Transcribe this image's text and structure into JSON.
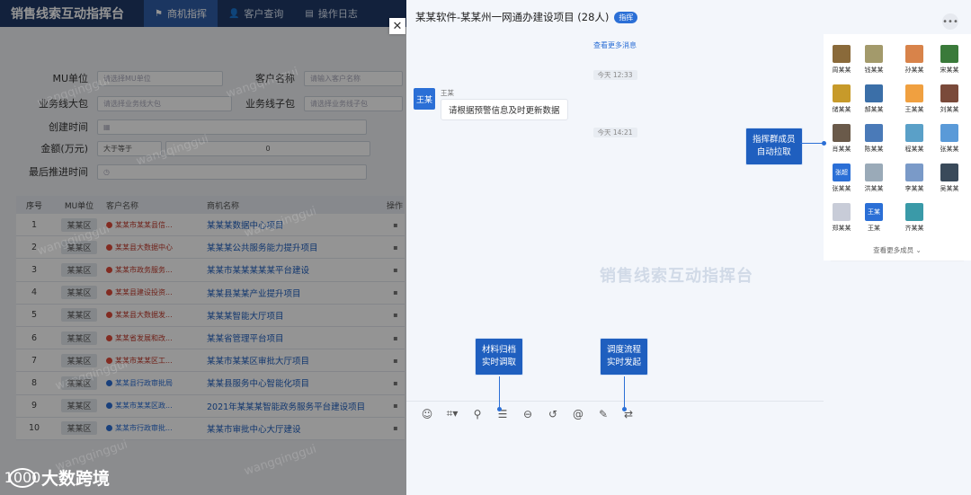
{
  "app": {
    "title": "销售线索互动指挥台",
    "nav": [
      {
        "icon": "flag-icon",
        "glyph": "⚑",
        "label": "商机指挥"
      },
      {
        "icon": "user-icon",
        "glyph": "👤",
        "label": "客户查询"
      },
      {
        "icon": "log-icon",
        "glyph": "▤",
        "label": "操作日志"
      }
    ],
    "filters": {
      "mu_label": "MU单位",
      "mu_placeholder": "请选择MU单位",
      "customer_label": "客户名称",
      "customer_placeholder": "请输入客户名称",
      "biz_pkg_label": "业务线大包",
      "biz_pkg_placeholder": "请选择业务线大包",
      "biz_sub_label": "业务线子包",
      "biz_sub_placeholder": "请选择业务线子包",
      "created_label": "创建时间",
      "amount_label": "金额(万元)",
      "amount_op": "大于等于",
      "amount_value": "0",
      "last_label": "最后推进时间"
    },
    "table": {
      "headers": {
        "no": "序号",
        "mu": "MU单位",
        "customer": "客户名称",
        "opportunity": "商机名称",
        "action": "操作"
      },
      "rows": [
        {
          "no": "1",
          "mu": "某某区",
          "customer": "某某市某某县信...",
          "status": "red",
          "opportunity": "某某某数据中心项目"
        },
        {
          "no": "2",
          "mu": "某某区",
          "customer": "某某县大数据中心",
          "status": "red",
          "opportunity": "某某某公共服务能力提升项目"
        },
        {
          "no": "3",
          "mu": "某某区",
          "customer": "某某市政务服务...",
          "status": "red",
          "opportunity": "某某市某某某某某平台建设"
        },
        {
          "no": "4",
          "mu": "某某区",
          "customer": "某某县建设投资...",
          "status": "red",
          "opportunity": "某某县某某产业提升项目"
        },
        {
          "no": "5",
          "mu": "某某区",
          "customer": "某某县大数据发...",
          "status": "red",
          "opportunity": "某某某智能大厅项目"
        },
        {
          "no": "6",
          "mu": "某某区",
          "customer": "某某省发展和改...",
          "status": "red",
          "opportunity": "某某省管理平台项目"
        },
        {
          "no": "7",
          "mu": "某某区",
          "customer": "某某市某某区工...",
          "status": "red",
          "opportunity": "某某市某某区审批大厅项目"
        },
        {
          "no": "8",
          "mu": "某某区",
          "customer": "某某县行政审批局",
          "status": "blue",
          "opportunity": "某某县服务中心智能化项目"
        },
        {
          "no": "9",
          "mu": "某某区",
          "customer": "某某市某某区政...",
          "status": "blue",
          "opportunity": "2021年某某某智能政务服务平台建设项目"
        },
        {
          "no": "10",
          "mu": "某某区",
          "customer": "某某市行政审批...",
          "status": "blue",
          "opportunity": "某某市审批中心大厅建设"
        }
      ]
    },
    "watermark": "wangqinggui",
    "brand": {
      "logo": "1000",
      "name": "大数跨境"
    }
  },
  "chat": {
    "group_name": "某某软件-某某州一网通办建设项目 (28人)",
    "group_tag": "指挥",
    "load_more": "查看更多消息",
    "time1": "今天 12:33",
    "time2": "今天 14:21",
    "sender_avatar": "王某",
    "sender_name": "王某",
    "message": "请根据预警信息及时更新数据",
    "center_watermark": "销售线索互动指挥台",
    "members_more": "查看更多成员",
    "members": [
      {
        "name": "周某某",
        "color": "#8a6a3a"
      },
      {
        "name": "钱某某",
        "color": "#a39a6b"
      },
      {
        "name": "孙某某",
        "color": "#d8834a"
      },
      {
        "name": "宋某某",
        "color": "#3a7a3a"
      },
      {
        "name": "储某某",
        "color": "#c79a2a"
      },
      {
        "name": "郝某某",
        "color": "#3b6fa8"
      },
      {
        "name": "王某某",
        "color": "#f0a040"
      },
      {
        "name": "刘某某",
        "color": "#7a4a3a"
      },
      {
        "name": "肖某某",
        "color": "#6a5a4a"
      },
      {
        "name": "陈某某",
        "color": "#4a7ab8"
      },
      {
        "name": "程某某",
        "color": "#5aa0c8"
      },
      {
        "name": "张某某",
        "color": "#5a9ad8"
      },
      {
        "name": "张某某",
        "color": "#2b6fd6",
        "text": "张超"
      },
      {
        "name": "洪某某",
        "color": "#9aaab8"
      },
      {
        "name": "李某某",
        "color": "#7a9ac8"
      },
      {
        "name": "吴某某",
        "color": "#3a4a5a"
      },
      {
        "name": "郑某某",
        "color": "#c8ccd8"
      },
      {
        "name": "王某",
        "color": "#2b6fd6",
        "text": "王某"
      },
      {
        "name": "齐某某",
        "color": "#3a9aa8"
      }
    ],
    "callouts": {
      "members": "指挥群成员\n自动拉取",
      "materials": "材料归档\n实时调取",
      "flow": "调度流程\n实时发起"
    },
    "toolbar": [
      {
        "icon": "emoji-icon",
        "glyph": "☺"
      },
      {
        "icon": "screenshot-icon",
        "glyph": "⌗▾"
      },
      {
        "icon": "attachment-icon",
        "glyph": "⚲"
      },
      {
        "icon": "list-icon",
        "glyph": "☰"
      },
      {
        "icon": "minus-circle-icon",
        "glyph": "⊖"
      },
      {
        "icon": "history-icon",
        "glyph": "↺"
      },
      {
        "icon": "at-icon",
        "glyph": "@"
      },
      {
        "icon": "edit-icon",
        "glyph": "✎"
      },
      {
        "icon": "flow-icon",
        "glyph": "⇄"
      }
    ]
  }
}
